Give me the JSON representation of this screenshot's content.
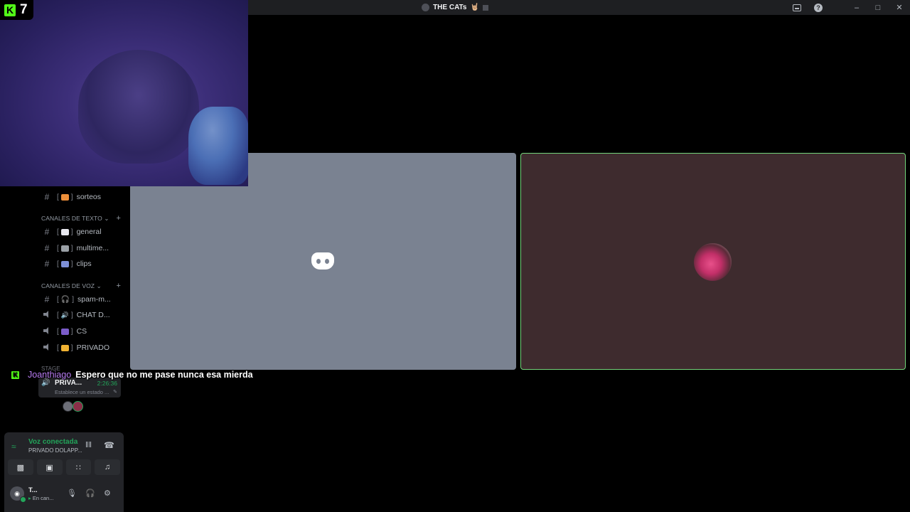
{
  "window": {
    "title": "THE CATs",
    "title_emoji": "🤘🏼"
  },
  "overlay": {
    "kick_badge": "K",
    "kick_count": "7"
  },
  "channels": {
    "top": [
      {
        "label": "sorteos",
        "emoji_color": "#ed8f3a"
      }
    ],
    "text_category": "CANALES DE TEXTO",
    "text": [
      {
        "label": "general",
        "emoji_color": "#e7e7ee"
      },
      {
        "label": "multime...",
        "emoji_color": "#9aa0a6"
      },
      {
        "label": "clips",
        "emoji_color": "#7d8fd6"
      }
    ],
    "voice_category": "CANALES DE VOZ",
    "voice": [
      {
        "label": "spam-m...",
        "icon": "#"
      },
      {
        "label": "CHAT D...",
        "icon": "speaker"
      },
      {
        "label": "CS",
        "icon": "speaker"
      },
      {
        "label": "PRIVADO",
        "icon": "speaker"
      }
    ],
    "stage_category": "STAGE"
  },
  "voice_pill": {
    "name": "PRIVA...",
    "time": "2:26:36",
    "status": "Establece un estado ..."
  },
  "chat": {
    "badge": "K",
    "user": "Joanthiago",
    "message": "Espero que no me pase nunca esa mierda"
  },
  "panel": {
    "voice_title": "Voz conectada",
    "voice_channel": "PRIVADO DOLAPP...",
    "user_name": "T...",
    "user_status": "En can..."
  },
  "colors": {
    "accent_green": "#23a55a",
    "kick_green": "#53fc18",
    "speaking_border": "#73d67b"
  }
}
